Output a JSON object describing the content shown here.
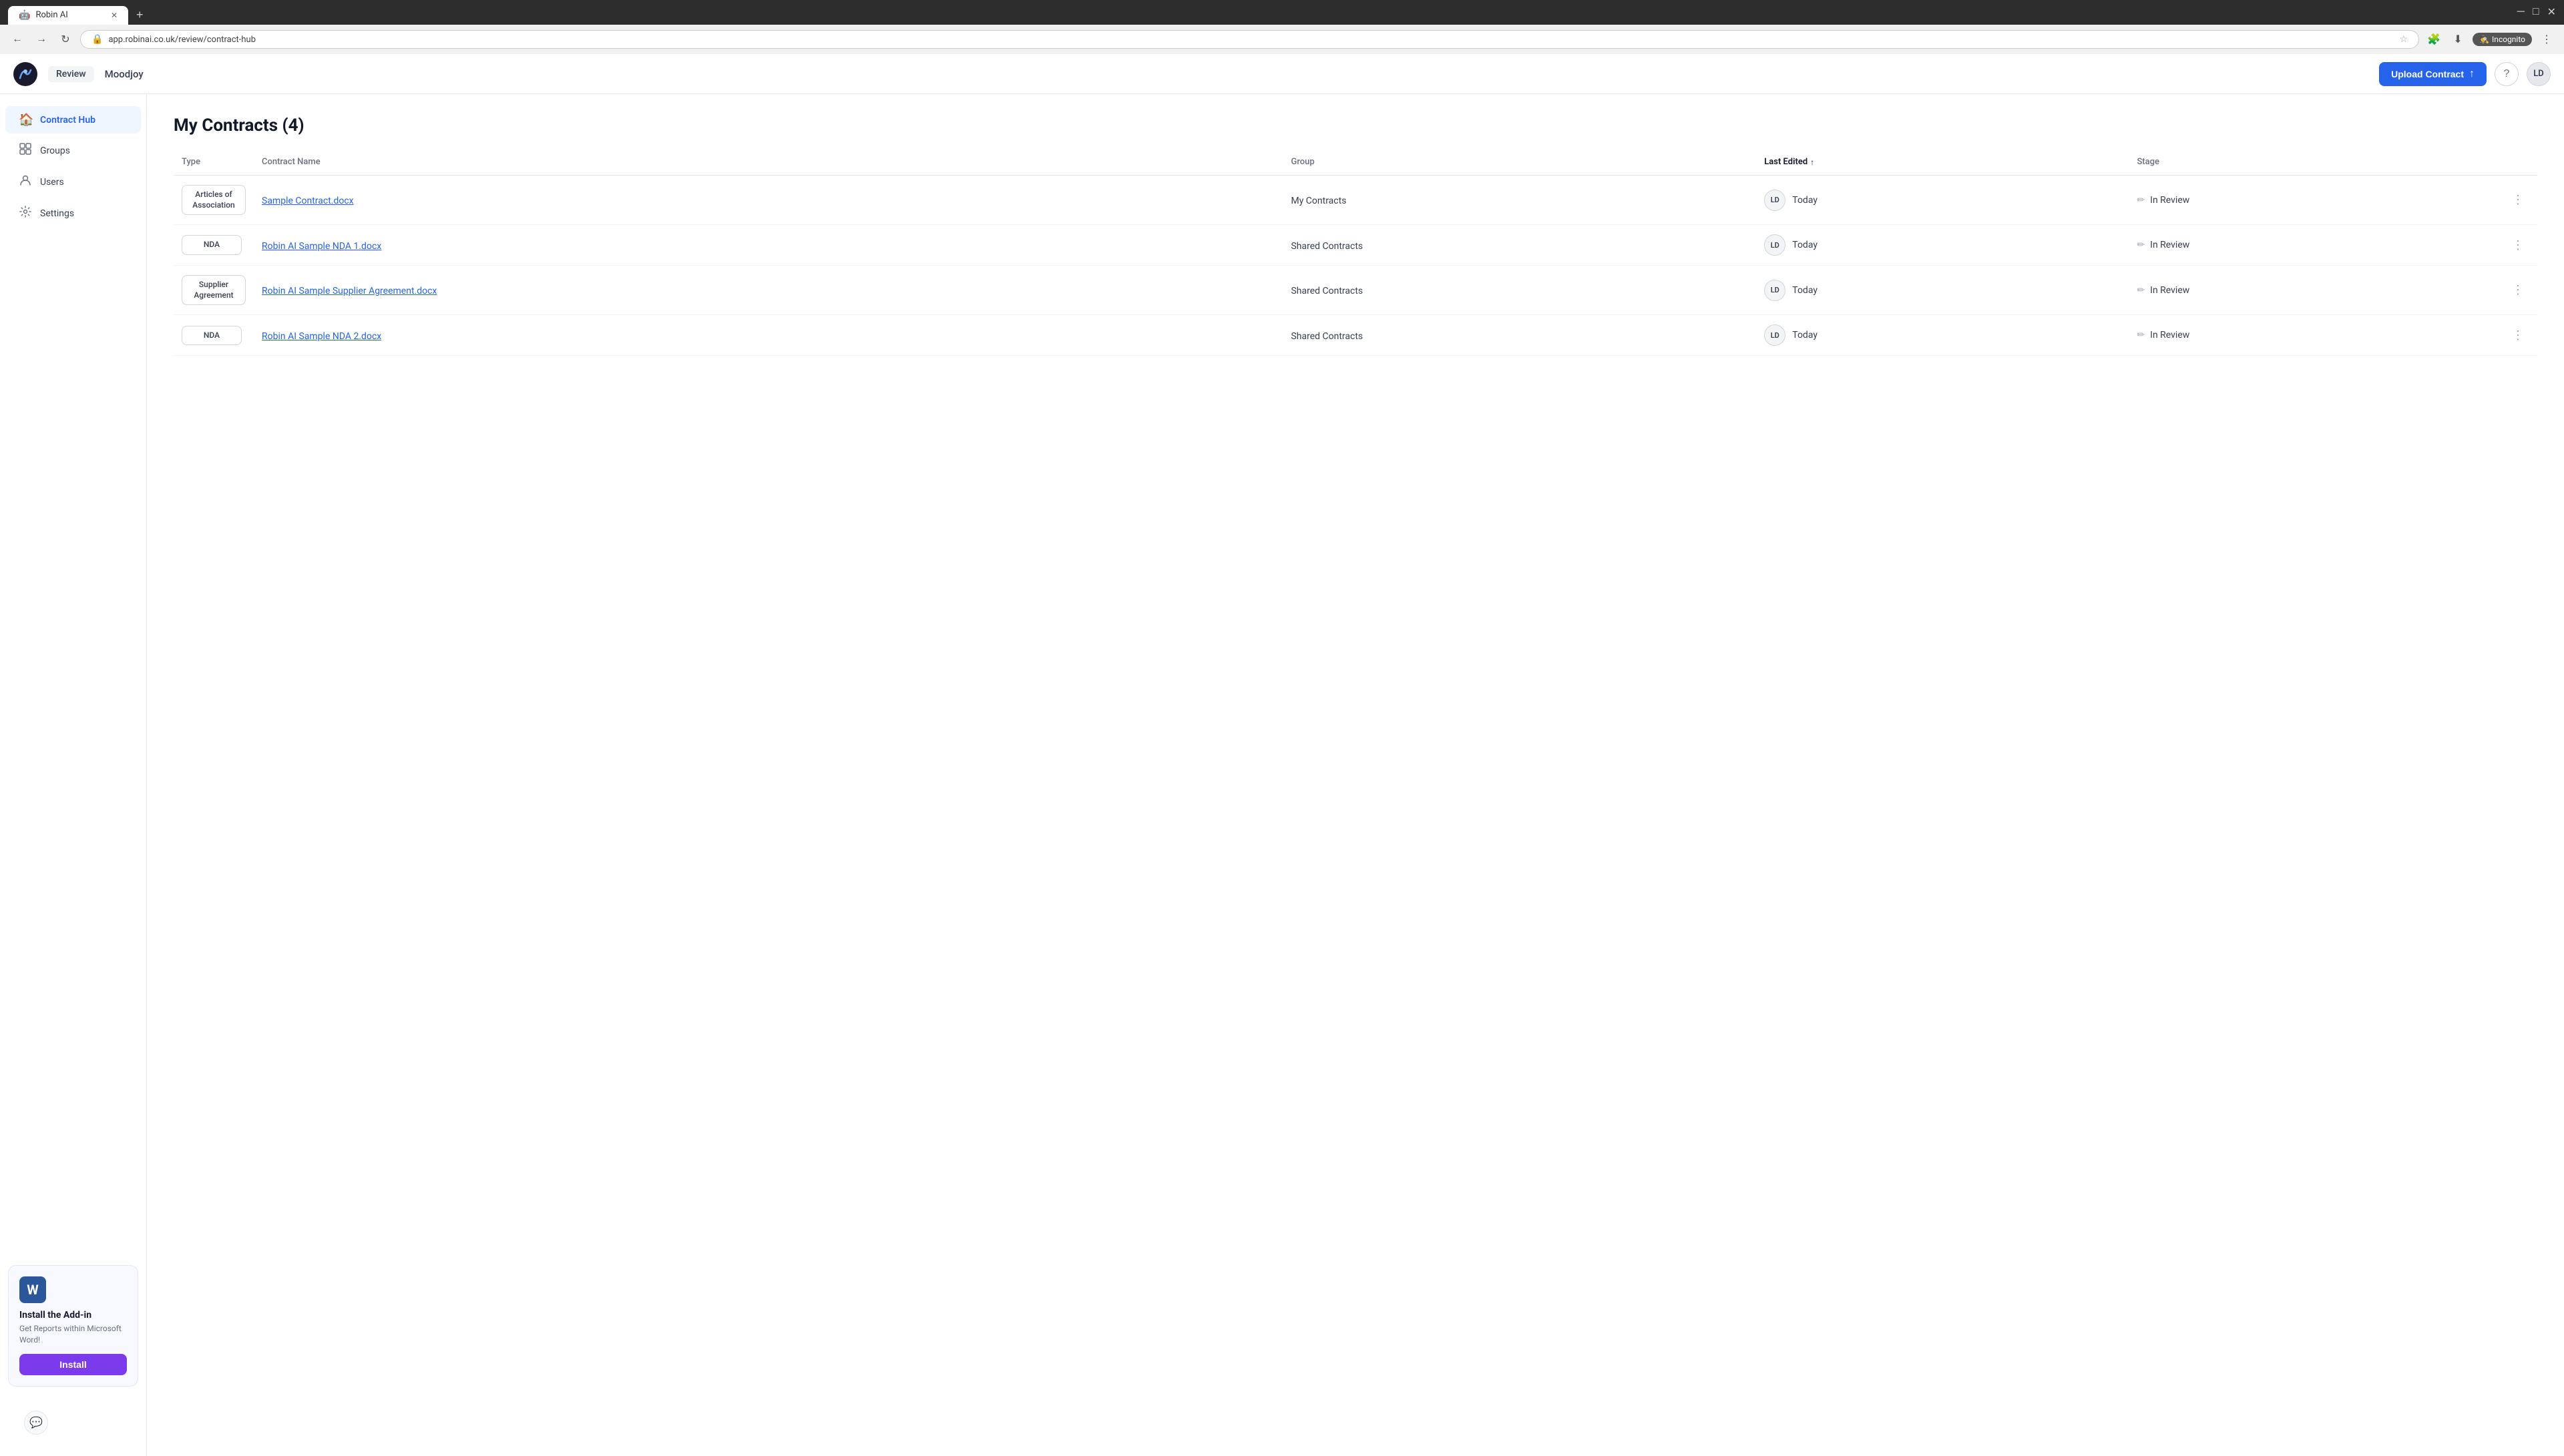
{
  "browser": {
    "tab_label": "Robin AI",
    "tab_icon": "🤖",
    "new_tab_symbol": "+",
    "address": "app.robinai.co.uk/review/contract-hub",
    "incognito_label": "Incognito"
  },
  "header": {
    "review_label": "Review",
    "company_name": "Moodjoy",
    "upload_btn_label": "Upload Contract",
    "help_icon": "?",
    "user_initials": "LD"
  },
  "sidebar": {
    "items": [
      {
        "label": "Contract Hub",
        "icon": "🏠",
        "active": true
      },
      {
        "label": "Groups",
        "icon": "⊞"
      },
      {
        "label": "Users",
        "icon": "👤"
      },
      {
        "label": "Settings",
        "icon": "⚙"
      }
    ],
    "addin": {
      "title": "Install the Add-in",
      "description": "Get Reports within Microsoft Word!",
      "install_label": "Install"
    },
    "feedback_icon": "💬"
  },
  "main": {
    "page_title": "My Contracts (4)",
    "table": {
      "columns": [
        "Type",
        "Contract Name",
        "Group",
        "Last Edited",
        "Stage"
      ],
      "rows": [
        {
          "type": "Articles of Association",
          "contract_name": "Sample Contract.docx",
          "group": "My Contracts",
          "avatar": "LD",
          "last_edited": "Today",
          "stage": "In Review"
        },
        {
          "type": "NDA",
          "contract_name": "Robin AI Sample NDA 1.docx",
          "group": "Shared Contracts",
          "avatar": "LD",
          "last_edited": "Today",
          "stage": "In Review"
        },
        {
          "type": "Supplier Agreement",
          "contract_name": "Robin AI Sample Supplier Agreement.docx",
          "group": "Shared Contracts",
          "avatar": "LD",
          "last_edited": "Today",
          "stage": "In Review"
        },
        {
          "type": "NDA",
          "contract_name": "Robin AI Sample NDA 2.docx",
          "group": "Shared Contracts",
          "avatar": "LD",
          "last_edited": "Today",
          "stage": "In Review"
        }
      ]
    }
  },
  "colors": {
    "accent": "#2563eb",
    "upload_btn": "#2563eb",
    "install_btn": "#7c3aed",
    "link": "#2563eb"
  }
}
